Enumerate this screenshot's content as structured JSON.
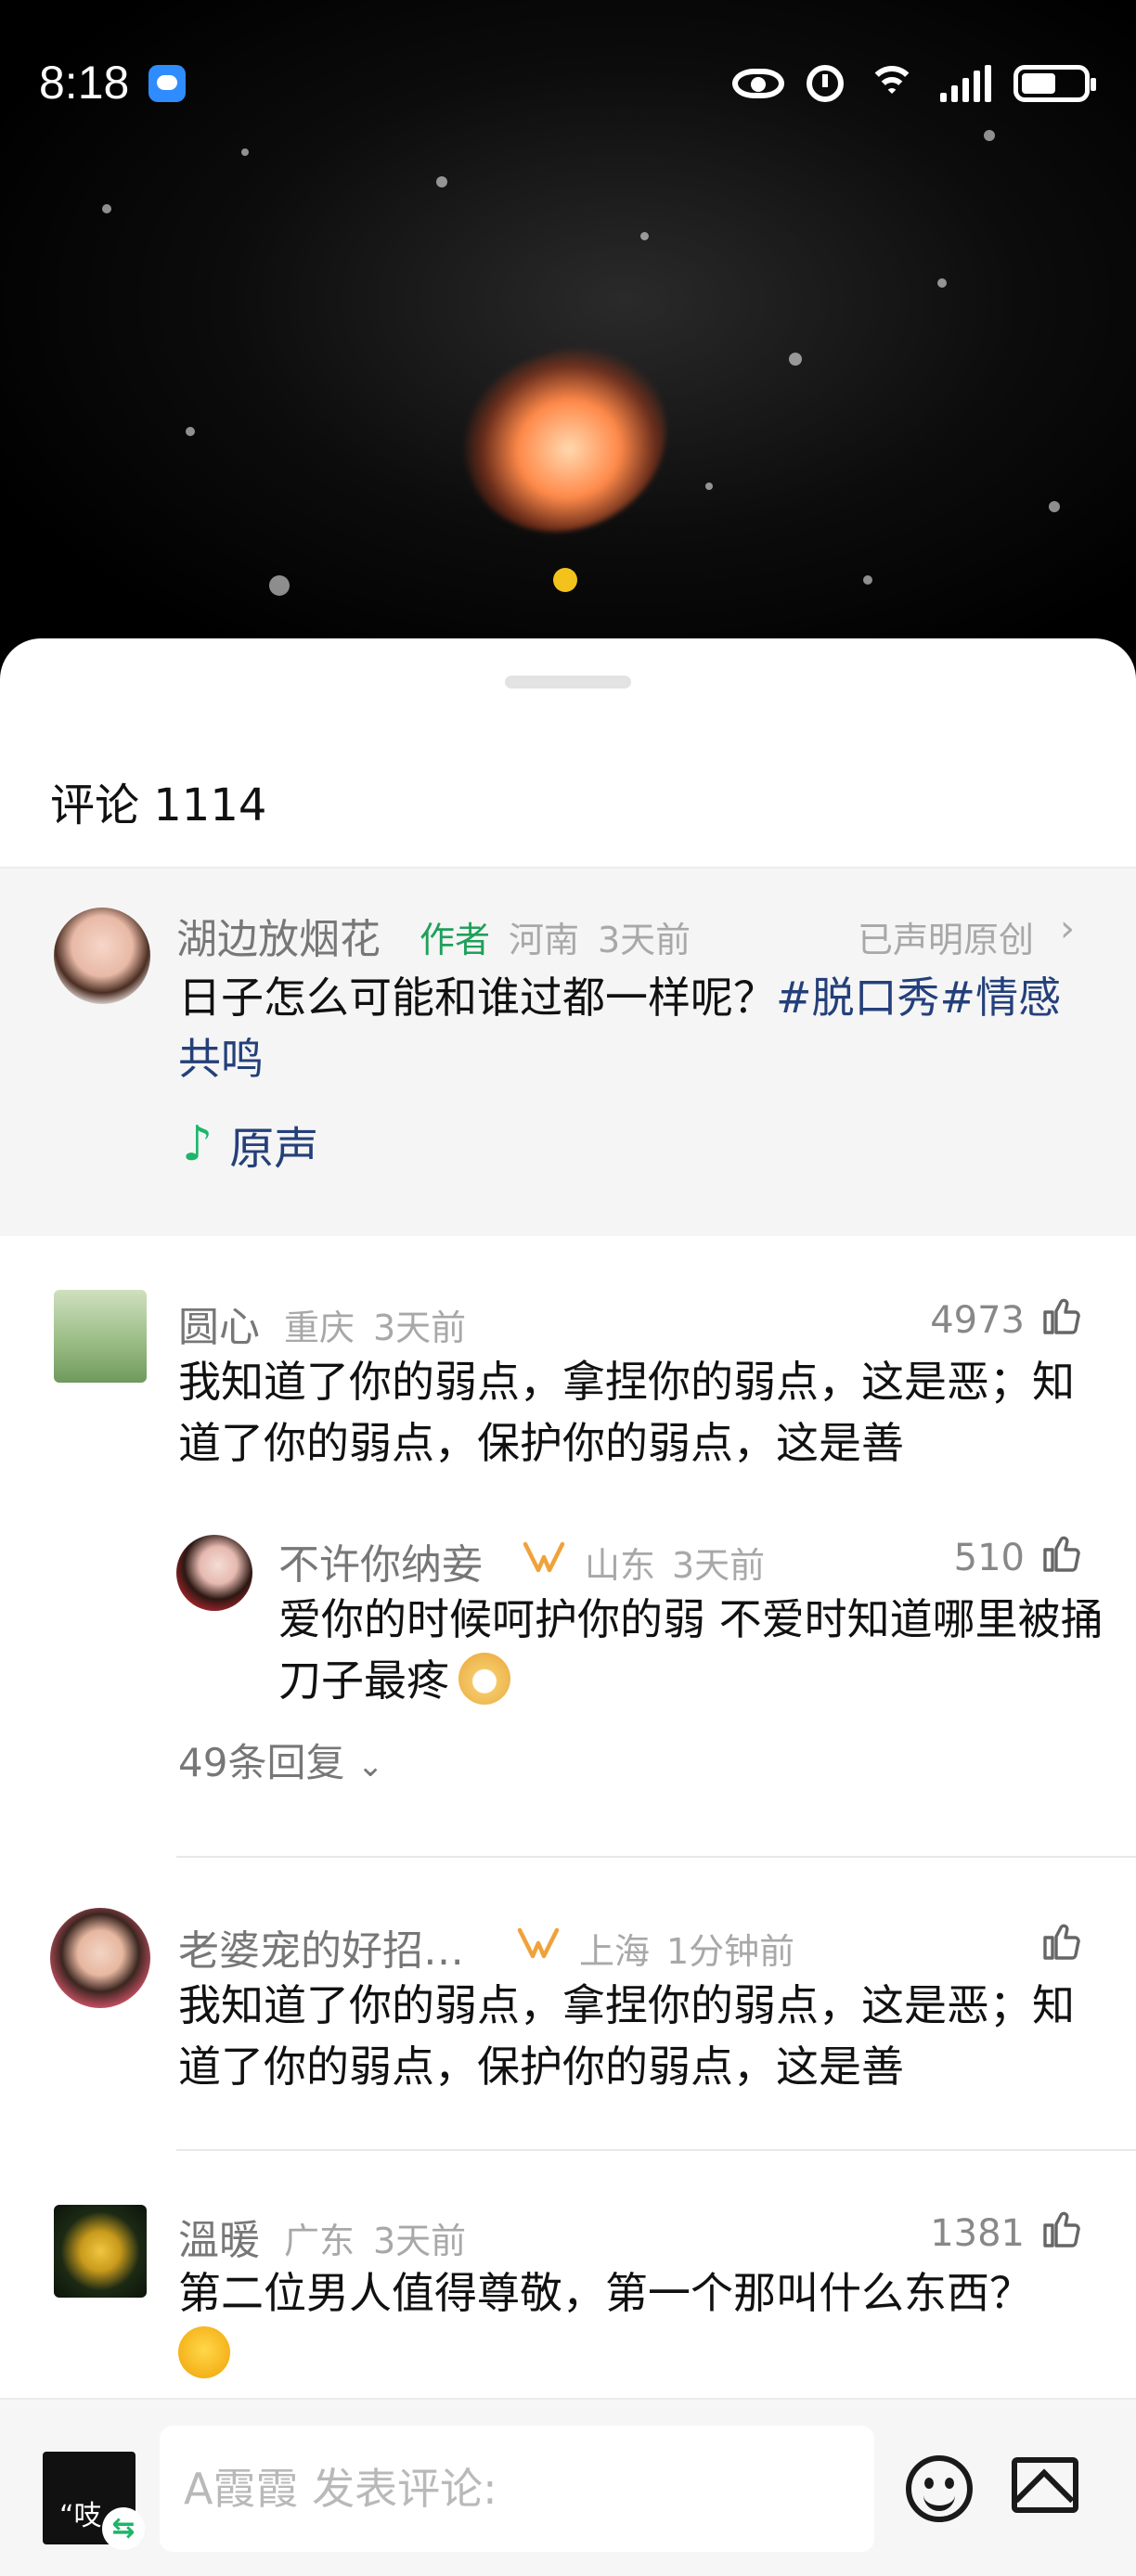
{
  "status_bar": {
    "time": "8:18"
  },
  "comments_panel": {
    "title": "评论 1114"
  },
  "author_post": {
    "username": "湖边放烟花",
    "tag": "作者",
    "location": "河南",
    "time_ago": "3天前",
    "originality_label": "已声明原创",
    "caption": "日子怎么可能和谁过都一样呢？",
    "hashtag_1": "#脱口秀",
    "hashtag_2": "#情感共鸣",
    "sound_label": "原声"
  },
  "comments": [
    {
      "username": "圆心",
      "location": "重庆",
      "time_ago": "3天前",
      "likes": "4973",
      "text": "我知道了你的弱点，拿捏你的弱点，这是恶；知道了你的弱点，保护你的弱点，这是善",
      "reply": {
        "username": "不许你纳妾",
        "location": "山东",
        "time_ago": "3天前",
        "likes": "510",
        "text": "爱你的时候呵护你的弱 不爱时知道哪里被捅刀子最疼"
      },
      "reply_count_label": "49条回复"
    },
    {
      "username": "老婆宠的好招…",
      "location": "上海",
      "time_ago": "1分钟前",
      "likes": "",
      "text": "我知道了你的弱点，拿捏你的弱点，这是恶；知道了你的弱点，保护你的弱点，这是善"
    },
    {
      "username": "溫暖",
      "location": "广东",
      "time_ago": "3天前",
      "likes": "1381",
      "text": "第二位男人值得尊敬，第一个那叫什么东西？"
    }
  ],
  "input_bar": {
    "placeholder": "A霞霞 发表评论:",
    "avatar_text": "“吱"
  },
  "icons": {
    "like": "thumbs-up-icon",
    "emoji": "smiley-icon",
    "image": "image-icon",
    "note": "music-note-icon",
    "vip": "vip-badge-icon"
  },
  "colors": {
    "author_tag": "#1fa05a",
    "hashtag": "#24407a",
    "vip_badge": "#f0a23a"
  }
}
